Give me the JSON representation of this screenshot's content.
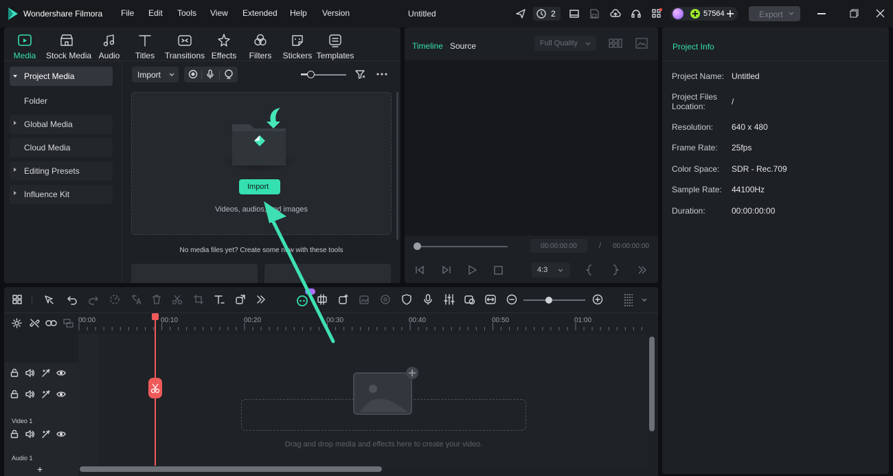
{
  "app": {
    "name": "Wondershare Filmora",
    "project_title": "Untitled",
    "menu": [
      "File",
      "Edit",
      "Tools",
      "View",
      "Extended",
      "Help",
      "Version"
    ],
    "notification_count": "2",
    "credits": "57564",
    "export_label": "Export"
  },
  "tool_tabs": [
    "Media",
    "Stock Media",
    "Audio",
    "Titles",
    "Transitions",
    "Effects",
    "Filters",
    "Stickers",
    "Templates"
  ],
  "sidebar": {
    "items": [
      "Project Media",
      "Folder",
      "Global Media",
      "Cloud Media",
      "Editing Presets",
      "Influence Kit"
    ]
  },
  "media": {
    "import_dropdown": "Import",
    "import_button": "Import",
    "hint": "Videos, audios, and images",
    "empty_text": "No media files yet? Create some now with these tools"
  },
  "preview": {
    "tab_timeline": "Timeline",
    "tab_source": "Source",
    "quality": "Full Quality",
    "current_time": "00:00:00:00",
    "separator": "/",
    "total_time": "00:00:00:00",
    "aspect": "4:3",
    "accent": "#35e0b0"
  },
  "project_info": {
    "title": "Project Info",
    "rows": [
      {
        "label": "Project Name:",
        "value": "Untitled"
      },
      {
        "label": "Project Files Location:",
        "value": "/"
      },
      {
        "label": "Resolution:",
        "value": "640 x 480"
      },
      {
        "label": "Frame Rate:",
        "value": "25fps"
      },
      {
        "label": "Color Space:",
        "value": "SDR - Rec.709"
      },
      {
        "label": "Sample Rate:",
        "value": "44100Hz"
      },
      {
        "label": "Duration:",
        "value": "00:00:00:00"
      }
    ]
  },
  "timeline": {
    "ruler": [
      "00:00",
      "00:10",
      "00:20",
      "00:30",
      "00:40",
      "00:50",
      "01:00"
    ],
    "video_track": "Video 1",
    "audio_track": "Audio 1",
    "drop_hint": "Drag and drop media and effects here to create your video.",
    "add_track": "+"
  }
}
